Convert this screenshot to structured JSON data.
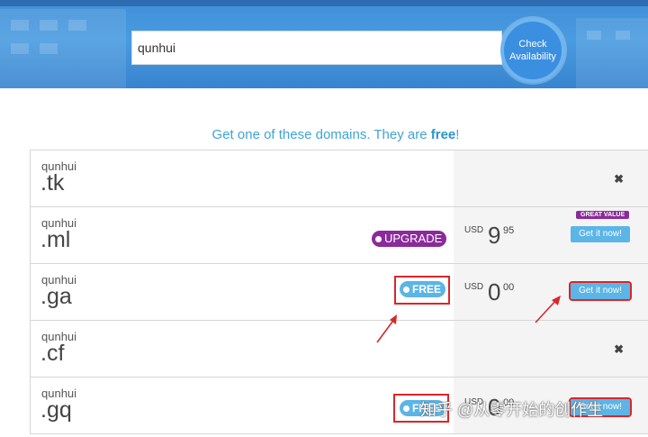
{
  "search": {
    "value": "qunhui",
    "button_label_line1": "Check",
    "button_label_line2": "Availability"
  },
  "headline": {
    "prefix": "Get one of these domains. They are ",
    "emphasis": "free",
    "suffix": "!"
  },
  "rows": [
    {
      "name": "qunhui",
      "tld": ".tk",
      "status": "unavailable"
    },
    {
      "name": "qunhui",
      "tld": ".ml",
      "badge": "UPGRADE",
      "currency": "USD",
      "price_whole": "9",
      "price_cents": "95",
      "tag": "GREAT VALUE",
      "button": "Get it now!"
    },
    {
      "name": "qunhui",
      "tld": ".ga",
      "badge": "FREE",
      "currency": "USD",
      "price_whole": "0",
      "price_cents": "00",
      "button": "Get it now!"
    },
    {
      "name": "qunhui",
      "tld": ".cf",
      "status": "unavailable"
    },
    {
      "name": "qunhui",
      "tld": ".gq",
      "badge": "FREE",
      "currency": "USD",
      "price_whole": "0",
      "price_cents": "00",
      "button": "Get it now!"
    }
  ],
  "watermark": "知乎 @从零开始的创作生",
  "colors": {
    "accent": "#5bb5e6",
    "purple": "#8b2a9b",
    "annotation_red": "#d9262b",
    "banner": "#3f8fd8"
  }
}
